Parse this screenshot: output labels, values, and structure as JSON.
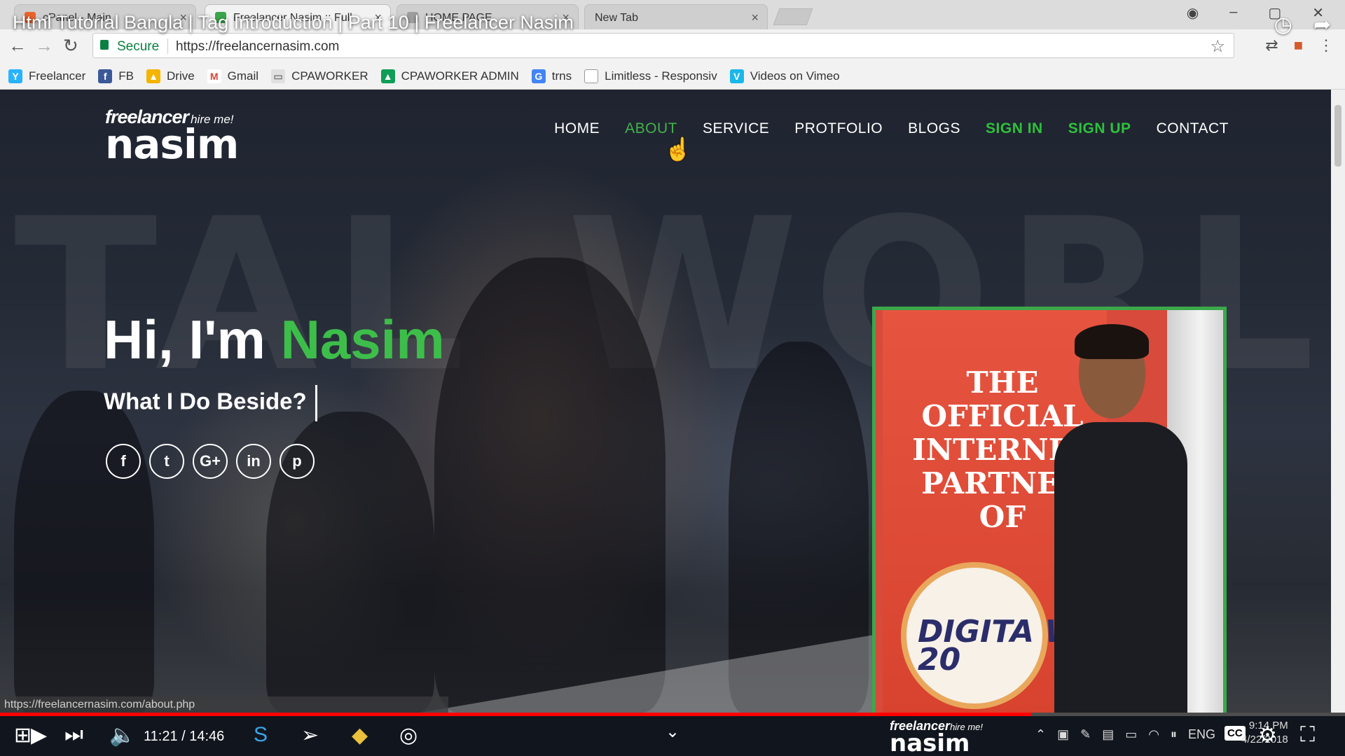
{
  "video": {
    "title": "Html Tutorial Bangla | Tag Introduction | Part 10 | Freelancer Nasim",
    "icons": [
      "watch-later-icon",
      "share-icon"
    ],
    "time_current": "11:21",
    "time_sep": " / ",
    "time_total": "14:46",
    "progress_fraction": 0.767
  },
  "browser": {
    "tabs": [
      {
        "label": "cPanel - Main",
        "favicon_color": "#e8632c"
      },
      {
        "label": "Freelancer Nasim :: Full",
        "favicon_color": "#3aa54a"
      },
      {
        "label": "HOME PAGE",
        "favicon_color": "#9e9e9e"
      },
      {
        "label": "New Tab",
        "favicon_color": "#cfcfcf"
      }
    ],
    "secure_label": "Secure",
    "url": "https://freelancernasim.com",
    "status_url": "https://freelancernasim.com/about.php",
    "bookmarks": [
      {
        "label": "Freelancer",
        "icon": "freelancer-icon",
        "color": "#29b2fe"
      },
      {
        "label": "FB",
        "icon": "facebook-icon",
        "color": "#3b5998"
      },
      {
        "label": "Drive",
        "icon": "drive-icon",
        "color": "#f4b400"
      },
      {
        "label": "Gmail",
        "icon": "gmail-icon",
        "color": "#d44638"
      },
      {
        "label": "CPAWORKER",
        "icon": "comment-icon",
        "color": "#9e9e9e"
      },
      {
        "label": "CPAWORKER ADMIN",
        "icon": "drive-icon",
        "color": "#0f9d58"
      },
      {
        "label": "trns",
        "icon": "translate-icon",
        "color": "#4285f4"
      },
      {
        "label": "Limitless - Responsiv",
        "icon": "page-icon",
        "color": "#9e9e9e"
      },
      {
        "label": "Videos on Vimeo",
        "icon": "vimeo-icon",
        "color": "#1ab7ea"
      }
    ]
  },
  "site": {
    "logo": {
      "top": "freelancer",
      "hire": "hire me!",
      "main": "nasim"
    },
    "nav": [
      {
        "label": "HOME",
        "style": "normal"
      },
      {
        "label": "ABOUT",
        "style": "hover"
      },
      {
        "label": "SERVICE",
        "style": "normal"
      },
      {
        "label": "PROTFOLIO",
        "style": "normal"
      },
      {
        "label": "BLOGS",
        "style": "normal"
      },
      {
        "label": "SIGN IN",
        "style": "green"
      },
      {
        "label": "SIGN UP",
        "style": "green"
      },
      {
        "label": "CONTACT",
        "style": "normal"
      }
    ],
    "hero": {
      "greeting": "Hi, I'm ",
      "name": "Nasim",
      "subtitle": "What I Do Beside?"
    },
    "socials": [
      {
        "icon": "facebook-icon",
        "glyph": "f"
      },
      {
        "icon": "twitter-icon",
        "glyph": "t"
      },
      {
        "icon": "google-plus-icon",
        "glyph": "G+"
      },
      {
        "icon": "linkedin-icon",
        "glyph": "in"
      },
      {
        "icon": "pinterest-icon",
        "glyph": "p"
      }
    ],
    "photo": {
      "banner_text": "THE OFFICIAL INTERNET PARTNER OF",
      "logo_text": "DIGITA WORLD 20"
    },
    "accent_color": "#3dbe4a"
  },
  "taskbar": {
    "watermark_top": "freelancer",
    "watermark_hire": "hire me!",
    "watermark_main": "nasim",
    "lang": "ENG",
    "cc_label": "CC",
    "clock_time": "9:14 PM",
    "clock_date": "4/22/2018"
  }
}
